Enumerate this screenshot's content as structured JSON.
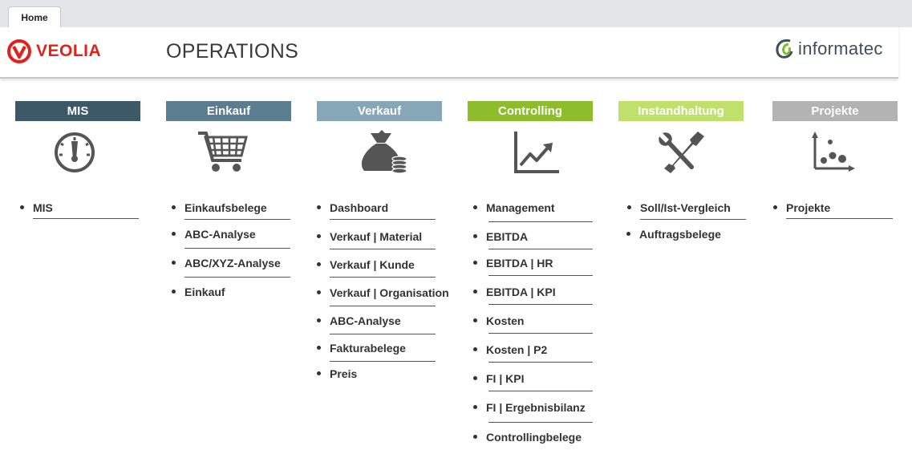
{
  "tab": {
    "label": "Home"
  },
  "header": {
    "veolia_logo_text": "VEOLIA",
    "title": "OPERATIONS",
    "informatec_logo_text": "informatec"
  },
  "colors": {
    "mis": "#3d5866",
    "einkauf": "#5a7d8f",
    "verkauf": "#86a7b8",
    "controlling": "#8dbd2a",
    "instandhaltung": "#bfe06a",
    "projekte": "#b3b3b3",
    "veolia_red": "#e2211c"
  },
  "columns": [
    {
      "title": "MIS",
      "icon": "gauge-icon",
      "items": [
        "MIS"
      ]
    },
    {
      "title": "Einkauf",
      "icon": "shopping-cart-icon",
      "items": [
        "Einkaufsbelege",
        "ABC-Analyse",
        "ABC/XYZ-Analyse",
        "Einkauf"
      ]
    },
    {
      "title": "Verkauf",
      "icon": "money-bag-icon",
      "items": [
        "Dashboard",
        "Verkauf | Material",
        "Verkauf | Kunde",
        "Verkauf | Organisation",
        "ABC-Analyse",
        "Fakturabelege",
        "Preis"
      ]
    },
    {
      "title": "Controlling",
      "icon": "line-chart-icon",
      "items": [
        "Management",
        "EBITDA",
        "EBITDA | HR",
        "EBITDA | KPI",
        "Kosten",
        "Kosten | P2",
        "FI | KPI",
        "FI | Ergebnisbilanz",
        "Controllingbelege"
      ]
    },
    {
      "title": "Instandhaltung",
      "icon": "wrench-screwdriver-icon",
      "items": [
        "Soll/Ist-Vergleich",
        "Auftragsbelege"
      ]
    },
    {
      "title": "Projekte",
      "icon": "scatter-chart-icon",
      "items": [
        "Projekte"
      ]
    }
  ]
}
